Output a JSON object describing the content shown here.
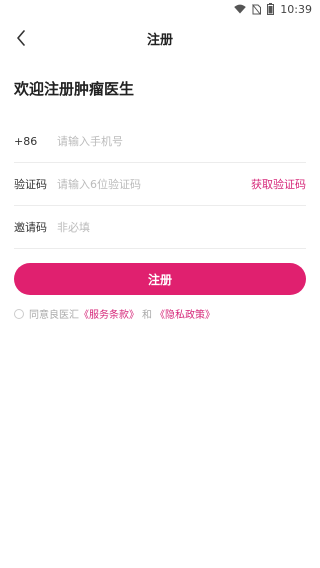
{
  "status_bar": {
    "time": "10:39",
    "icons": [
      "wifi-icon",
      "no-sim-icon",
      "battery-icon"
    ]
  },
  "header": {
    "title": "注册",
    "back_icon": "chevron-left-icon"
  },
  "welcome": {
    "text": "欢迎注册肿瘤医生"
  },
  "form": {
    "phone": {
      "prefix": "+86",
      "placeholder": "请输入手机号",
      "value": ""
    },
    "code": {
      "label": "验证码",
      "placeholder": "请输入6位验证码",
      "value": "",
      "get_code_label": "获取验证码"
    },
    "invite": {
      "label": "邀请码",
      "placeholder": "非必填",
      "value": ""
    }
  },
  "register_button": {
    "label": "注册"
  },
  "agreement": {
    "prefix": "同意良医汇",
    "terms_link": "《服务条款》",
    "and": "和",
    "privacy_link": "《隐私政策》"
  },
  "colors": {
    "accent": "#e0206f",
    "link": "#d6287a",
    "placeholder": "#bbbbbb",
    "divider": "#ececec"
  }
}
